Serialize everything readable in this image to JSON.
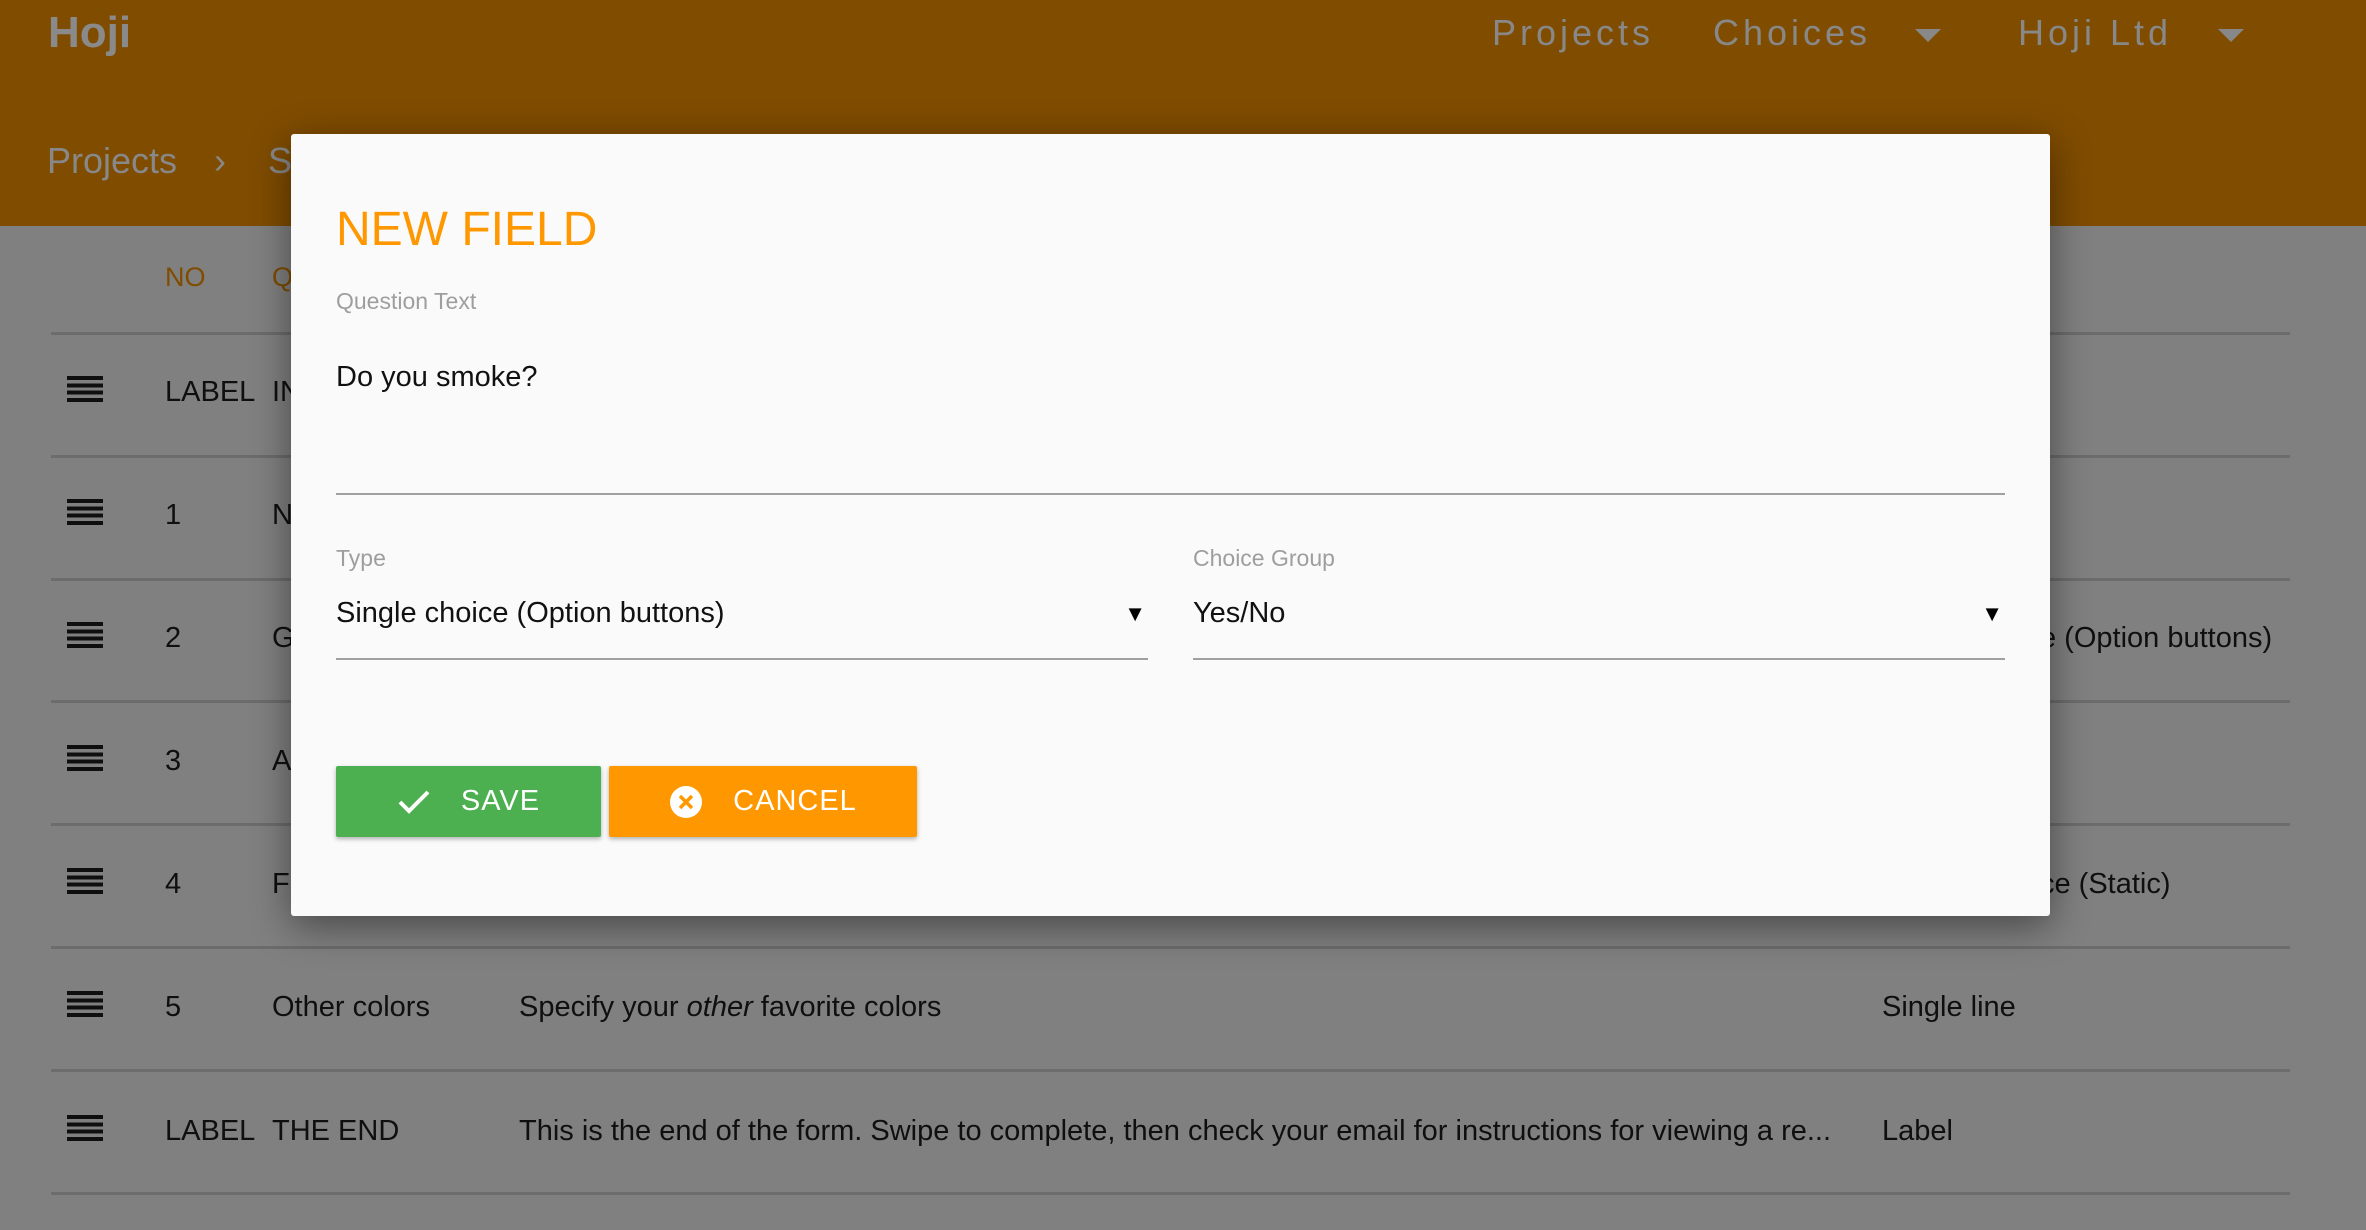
{
  "app": {
    "logo": "Hoji",
    "nav": [
      {
        "label": "Projects"
      },
      {
        "label": "Choices"
      },
      {
        "label": "Hoji Ltd"
      }
    ]
  },
  "breadcrumb": [
    "Projects",
    "S"
  ],
  "table": {
    "headers": {
      "no": "NO",
      "question": "Q"
    },
    "rows": [
      {
        "no": "LABEL",
        "name": "IN",
        "question": "",
        "type": ""
      },
      {
        "no": "1",
        "name": "N",
        "question": "",
        "type": ""
      },
      {
        "no": "2",
        "name": "G",
        "question": "",
        "type": "e (Option buttons)"
      },
      {
        "no": "3",
        "name": "A",
        "question": "",
        "type": ""
      },
      {
        "no": "4",
        "name": "F",
        "question": "",
        "type": "ce (Static)"
      },
      {
        "no": "5",
        "name": "Other colors",
        "question_pre": "Specify your ",
        "question_em": "other",
        "question_post": " favorite colors",
        "type": "Single line"
      },
      {
        "no": "LABEL",
        "name": "THE END",
        "question": "This is the end of the form. Swipe to complete, then check your email for instructions for viewing a re...",
        "type": "Label"
      }
    ]
  },
  "modal": {
    "title": "NEW FIELD",
    "question_label": "Question Text",
    "question_value": "Do you smoke?",
    "type_label": "Type",
    "type_value": "Single choice (Option buttons)",
    "group_label": "Choice Group",
    "group_value": "Yes/No",
    "save": "SAVE",
    "cancel": "CANCEL"
  },
  "colors": {
    "primary": "#ff9800",
    "save": "#4caf50",
    "cancel": "#ff9800"
  }
}
